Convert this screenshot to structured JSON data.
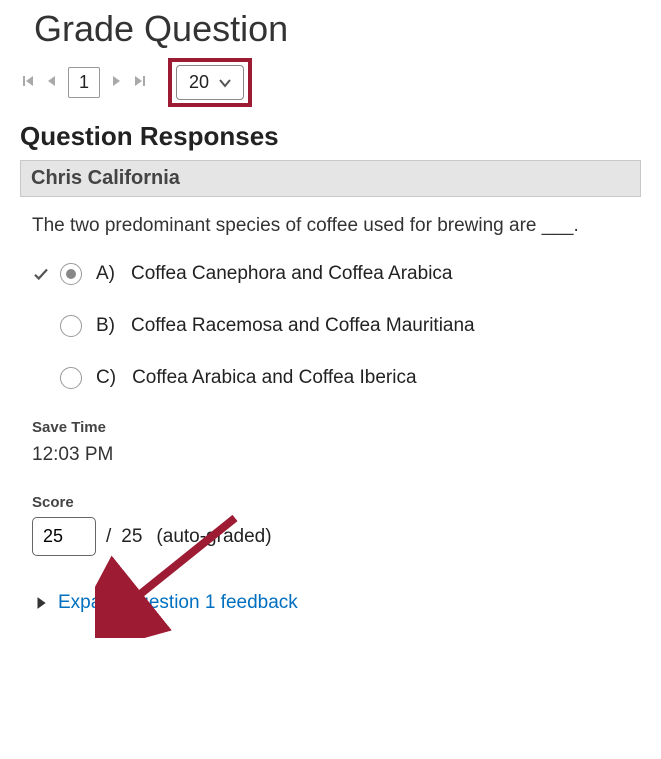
{
  "header": {
    "title": "Grade Question"
  },
  "pager": {
    "current_page": "1",
    "per_page": "20"
  },
  "section": {
    "title": "Question Responses"
  },
  "student": {
    "name": "Chris California"
  },
  "question": {
    "text": "The two predominant species of coffee used for brewing are ___.",
    "choices": [
      {
        "letter": "A)",
        "text": "Coffea Canephora and Coffea Arabica"
      },
      {
        "letter": "B)",
        "text": "Coffea Racemosa and Coffea Mauritiana"
      },
      {
        "letter": "C)",
        "text": "Coffea Arabica and Coffea Iberica"
      }
    ],
    "selected_index": 0,
    "correct_index": 0
  },
  "save_time": {
    "label": "Save Time",
    "value": "12:03 PM"
  },
  "score": {
    "label": "Score",
    "value": "25",
    "max": "25",
    "suffix": "(auto-graded)"
  },
  "feedback": {
    "expand_label": "Expand question 1 feedback"
  },
  "annotations": {
    "highlight_color": "#9e1b34"
  }
}
